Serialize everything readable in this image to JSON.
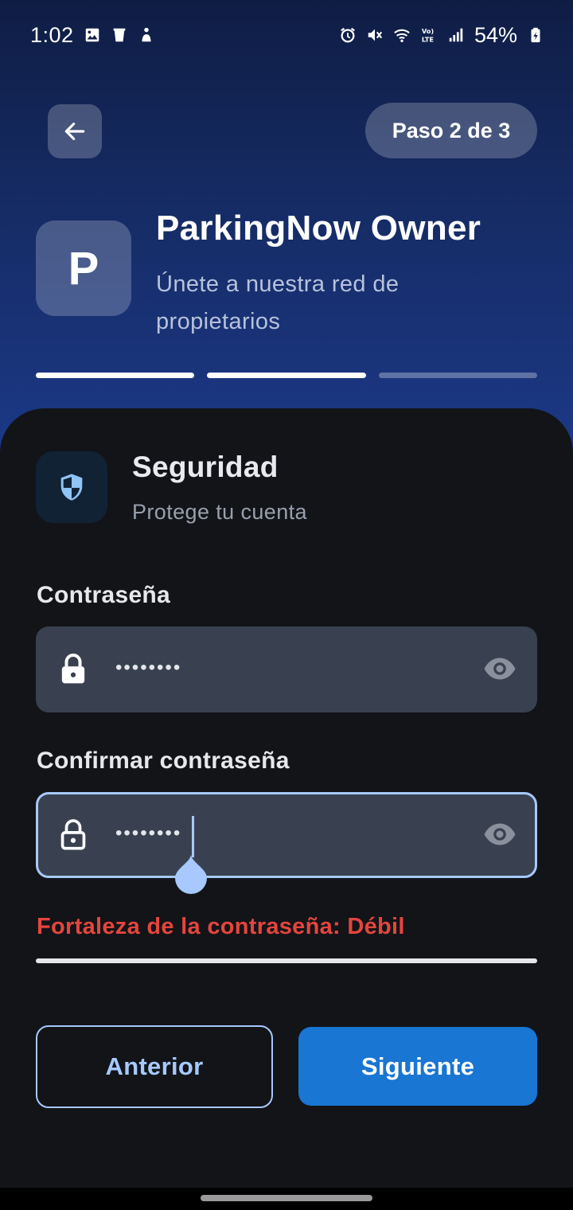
{
  "status_bar": {
    "time": "1:02",
    "battery": "54%",
    "left_icons": [
      "image-icon",
      "trash-icon",
      "accessibility-icon"
    ],
    "right_icons": [
      "alarm-icon",
      "mute-icon",
      "wifi-icon",
      "volte-icon",
      "signal-icon",
      "battery-icon"
    ]
  },
  "header": {
    "step": "Paso 2 de 3",
    "logo_letter": "P",
    "title": "ParkingNow Owner",
    "subtitle": "Únete a nuestra red de propietarios",
    "progress": {
      "total_steps": 3,
      "completed": 2
    }
  },
  "section": {
    "title": "Seguridad",
    "subtitle": "Protege tu cuenta",
    "icon": "shield-icon"
  },
  "form": {
    "password": {
      "label": "Contraseña",
      "value": "••••••••"
    },
    "confirm": {
      "label": "Confirmar contraseña",
      "value": "••••••••"
    },
    "strength": "Fortaleza de la contraseña: Débil"
  },
  "buttons": {
    "previous": "Anterior",
    "next": "Siguiente"
  },
  "colors": {
    "accent": "#1976d2",
    "outline": "#a7c9ff",
    "error": "#e5453d",
    "card_bg": "#121418"
  }
}
